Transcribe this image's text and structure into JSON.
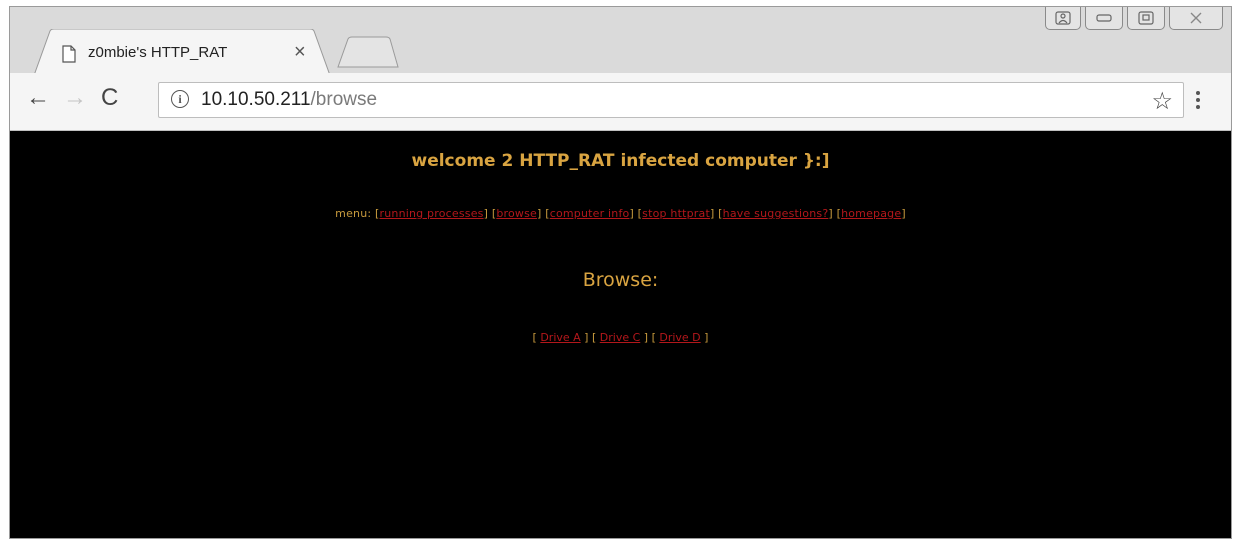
{
  "tab": {
    "title": "z0mbie's HTTP_RAT",
    "close": "×"
  },
  "toolbar": {
    "back": "←",
    "forward": "→",
    "reload": "C",
    "info": "i",
    "url_host": "10.10.50.211",
    "url_path": "/browse",
    "bookmark": "☆"
  },
  "page": {
    "welcome": "welcome 2 HTTP_RAT infected computer }:]",
    "menu_label": "menu:",
    "menu_items": [
      "running processes",
      "browse",
      "computer info",
      "stop httprat",
      "have suggestions?",
      "homepage"
    ],
    "browse_heading": "Browse:",
    "drives": [
      "Drive A",
      "Drive C",
      "Drive D"
    ]
  },
  "colors": {
    "page_background": "#000000",
    "text_gold": "#d9a441",
    "link_red": "#b3171b"
  }
}
